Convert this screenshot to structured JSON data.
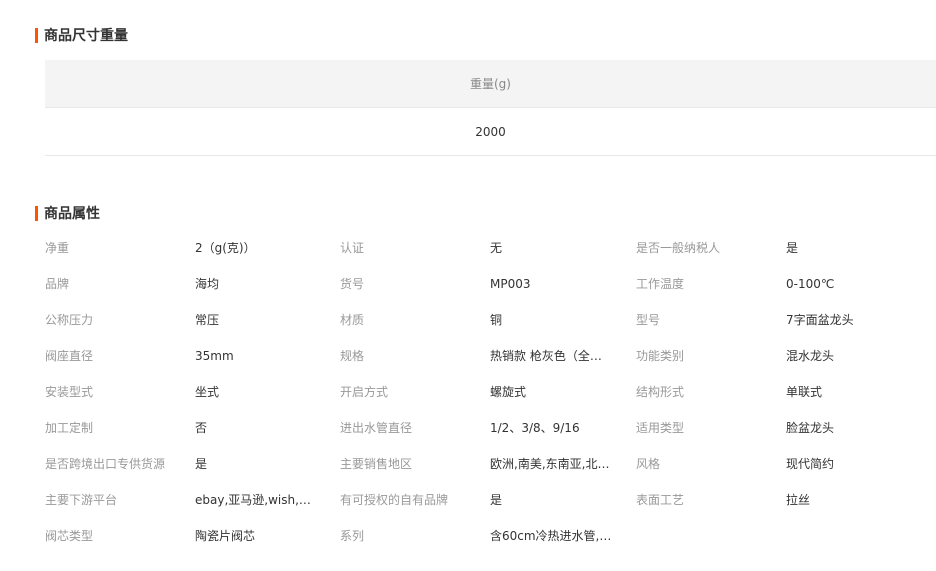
{
  "size_section": {
    "title": "商品尺寸重量",
    "header": "重量(g)",
    "value": "2000"
  },
  "attr_section": {
    "title": "商品属性",
    "rows": [
      [
        [
          "净重",
          "2（g(克)）"
        ],
        [
          "认证",
          "无"
        ],
        [
          "是否一般纳税人",
          "是"
        ]
      ],
      [
        [
          "品牌",
          "海均"
        ],
        [
          "货号",
          "MP003"
        ],
        [
          "工作温度",
          "0-100℃"
        ]
      ],
      [
        [
          "公称压力",
          "常压"
        ],
        [
          "材质",
          "铜"
        ],
        [
          "型号",
          "7字面盆龙头"
        ]
      ],
      [
        [
          "阀座直径",
          "35mm"
        ],
        [
          "规格",
          "热销款 枪灰色（全铝…"
        ],
        [
          "功能类别",
          "混水龙头"
        ]
      ],
      [
        [
          "安装型式",
          "坐式"
        ],
        [
          "开启方式",
          "螺旋式"
        ],
        [
          "结构形式",
          "单联式"
        ]
      ],
      [
        [
          "加工定制",
          "否"
        ],
        [
          "进出水管直径",
          "1/2、3/8、9/16"
        ],
        [
          "适用类型",
          "脸盆龙头"
        ]
      ],
      [
        [
          "是否跨境出口专供货源",
          "是"
        ],
        [
          "主要销售地区",
          "欧洲,南美,东南亚,北…"
        ],
        [
          "风格",
          "现代简约"
        ]
      ],
      [
        [
          "主要下游平台",
          "ebay,亚马逊,wish,速…"
        ],
        [
          "有可授权的自有品牌",
          "是"
        ],
        [
          "表面工艺",
          "拉丝"
        ]
      ],
      [
        [
          "阀芯类型",
          "陶瓷片阀芯"
        ],
        [
          "系列",
          "含60cm冷热进水管,…"
        ],
        [
          "",
          ""
        ]
      ]
    ]
  },
  "colors": {
    "accent_bar": "#ff5500",
    "header_bg": "#f4f4f4",
    "label_text": "#999999",
    "value_text": "#333333"
  }
}
